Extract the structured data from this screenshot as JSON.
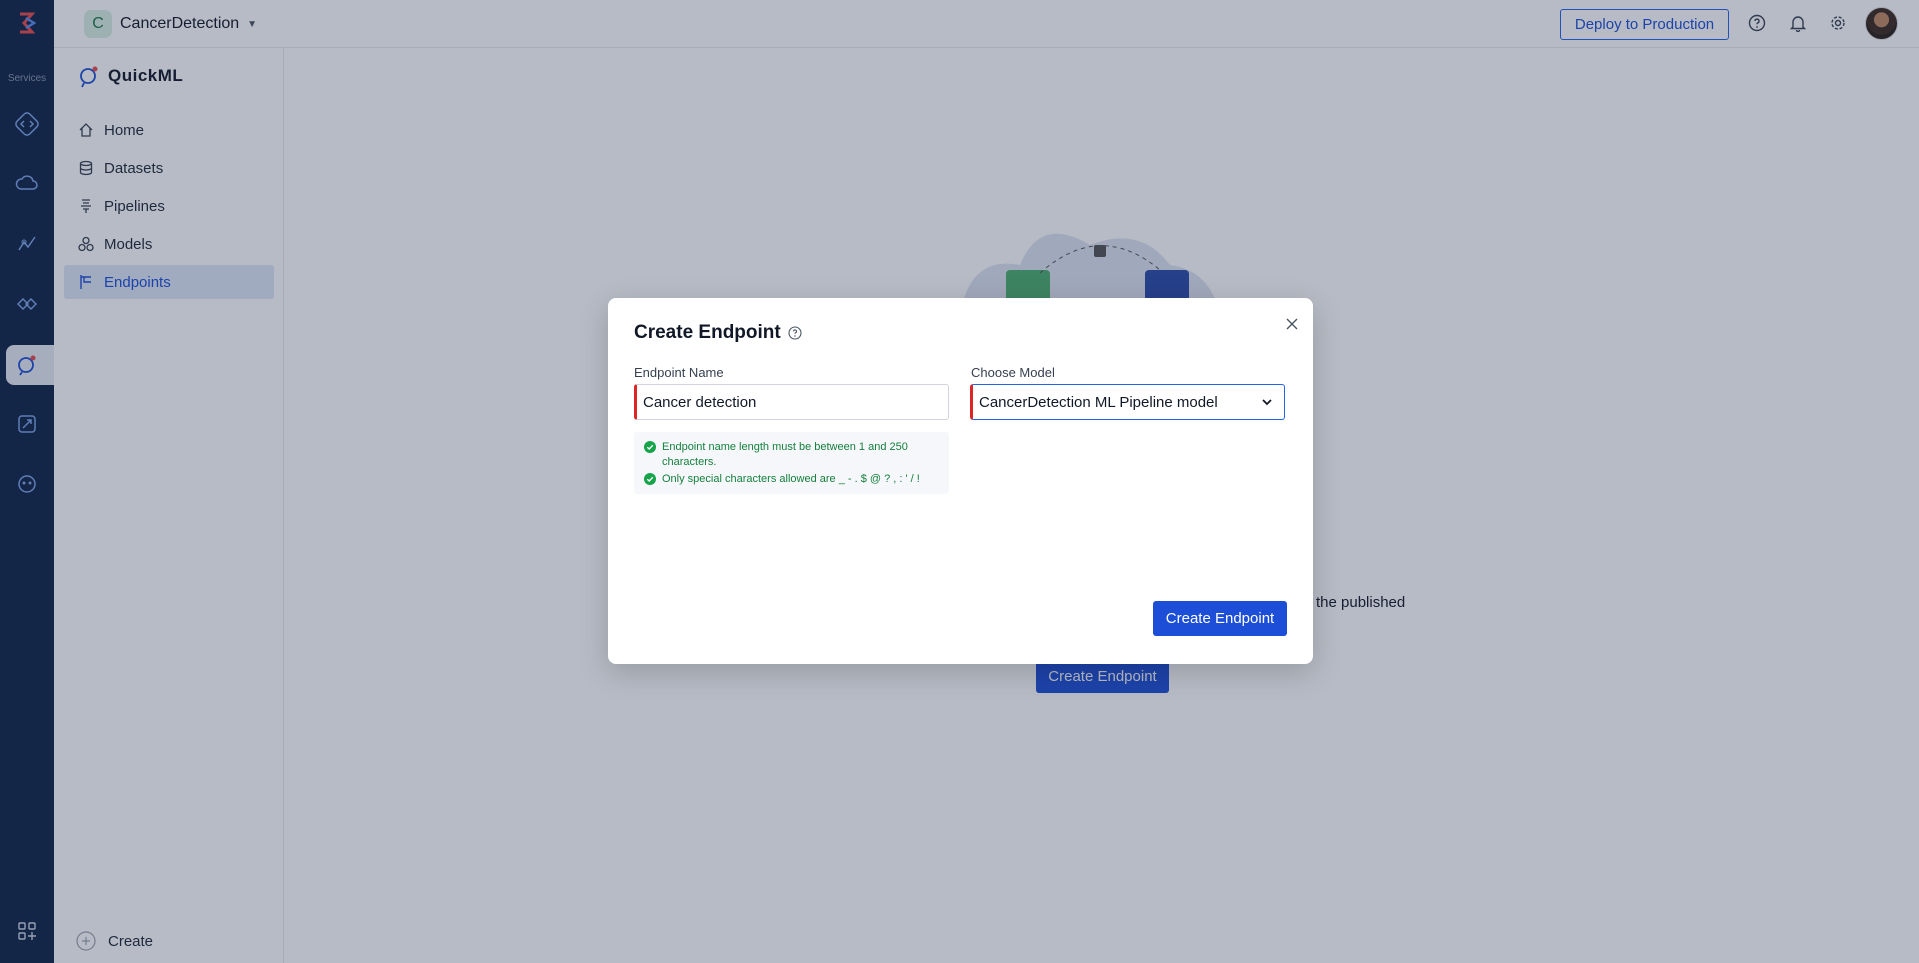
{
  "rail": {
    "services_label": "Services",
    "icons": [
      "code-icon",
      "cloud-icon",
      "analytics-icon",
      "integration-icon",
      "quickml-icon",
      "rocket-icon",
      "bot-icon"
    ],
    "apps_icon": "apps-grid-icon"
  },
  "header": {
    "project_initial": "C",
    "project_name": "CancerDetection",
    "deploy_label": "Deploy to Production"
  },
  "sidebar": {
    "brand": "QuickML",
    "items": [
      {
        "label": "Home",
        "icon": "home-icon"
      },
      {
        "label": "Datasets",
        "icon": "database-icon"
      },
      {
        "label": "Pipelines",
        "icon": "pipeline-icon"
      },
      {
        "label": "Models",
        "icon": "models-icon"
      },
      {
        "label": "Endpoints",
        "icon": "endpoint-icon",
        "active": true
      }
    ],
    "create_label": "Create"
  },
  "background": {
    "partial_text": "the published",
    "button_label": "Create Endpoint"
  },
  "modal": {
    "title": "Create Endpoint",
    "endpoint_label": "Endpoint Name",
    "endpoint_value": "Cancer detection",
    "model_label": "Choose Model",
    "model_value": "CancerDetection ML Pipeline model",
    "hints": [
      "Endpoint name length must be between 1 and 250 characters.",
      "Only special characters allowed are _ - . $ @ ? , : ' / !"
    ],
    "submit_label": "Create Endpoint"
  },
  "colors": {
    "accent": "#1d4ed8",
    "rail": "#0f2447",
    "error": "#dc2626",
    "success": "#15803d"
  }
}
